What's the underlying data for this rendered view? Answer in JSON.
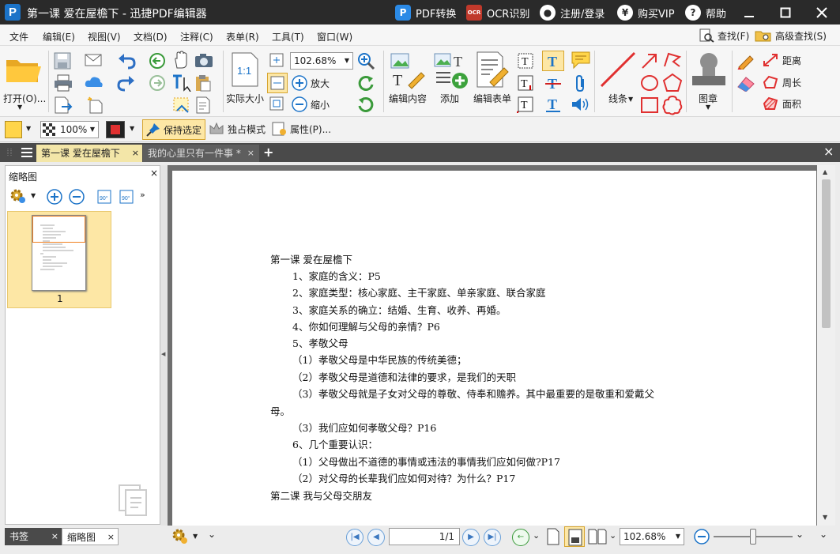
{
  "window": {
    "title": "第一课  爱在屋檐下 - 迅捷PDF编辑器",
    "actions": {
      "pdf_convert": "PDF转换",
      "ocr": "OCR识别",
      "register": "注册/登录",
      "buy_vip": "购买VIP",
      "help": "帮助"
    },
    "logo_glyph": "P",
    "ocr_glyph": "OCR",
    "user_glyph": "●",
    "yen_glyph": "¥",
    "help_glyph": "?"
  },
  "menu": {
    "items": [
      "文件",
      "编辑(E)",
      "视图(V)",
      "文档(D)",
      "注释(C)",
      "表单(R)",
      "工具(T)",
      "窗口(W)"
    ],
    "find": "查找(F)",
    "advanced_find": "高级查找(S)"
  },
  "ribbon": {
    "open": "打开(O)...",
    "actual_size": "实际大小",
    "actual_size_glyph": "1:1",
    "zoom_value": "102.68%",
    "zoom_in": "放大",
    "zoom_out": "缩小",
    "edit_content": "编辑内容",
    "add": "添加",
    "edit_form": "编辑表单",
    "lines": "线条",
    "stamp": "图章",
    "distance": "距离",
    "perimeter": "周长",
    "area": "面积"
  },
  "format_bar": {
    "opacity": "100%",
    "keep_selected": "保持选定",
    "exclusive_mode": "独占模式",
    "properties": "属性(P)..."
  },
  "tabs": [
    {
      "label": "第一课  爱在屋檐下",
      "active": true
    },
    {
      "label": "我的心里只有一件事 *",
      "active": false
    }
  ],
  "side_panel": {
    "title": "缩略图",
    "rotate_label": "90°",
    "thumb_page": "1"
  },
  "bottom_tabs": [
    "书签",
    "缩略图"
  ],
  "document_lines": [
    "第一课    爱在屋檐下",
    "1、家庭的含义：P5",
    "2、家庭类型：核心家庭、主干家庭、单亲家庭、联合家庭",
    "3、家庭关系的确立：结婚、生育、收养、再婚。",
    "4、你如何理解与父母的亲情？P6",
    "5、孝敬父母",
    "（1）孝敬父母是中华民族的传统美德；",
    "（2）孝敬父母是道德和法律的要求，是我们的天职",
    "（3）孝敬父母就是子女对父母的尊敬、侍奉和赡养。其中最重要的是敬重和爱戴父",
    "母。",
    "（3）我们应如何孝敬父母？P16",
    "6、几个重要认识：",
    "（1）父母做出不道德的事情或违法的事情我们应如何做?P17",
    "（2）对父母的长辈我们应如何对待？为什么？P17",
    "第二课    我与父母交朋友"
  ],
  "status": {
    "page_indicator": "1/1",
    "zoom": "102.68%"
  },
  "colors": {
    "accent_blue": "#1b73c8",
    "fill_yellow": "#ffd54a",
    "line_red": "#e03030",
    "tab_active": "#f3e6a8"
  }
}
